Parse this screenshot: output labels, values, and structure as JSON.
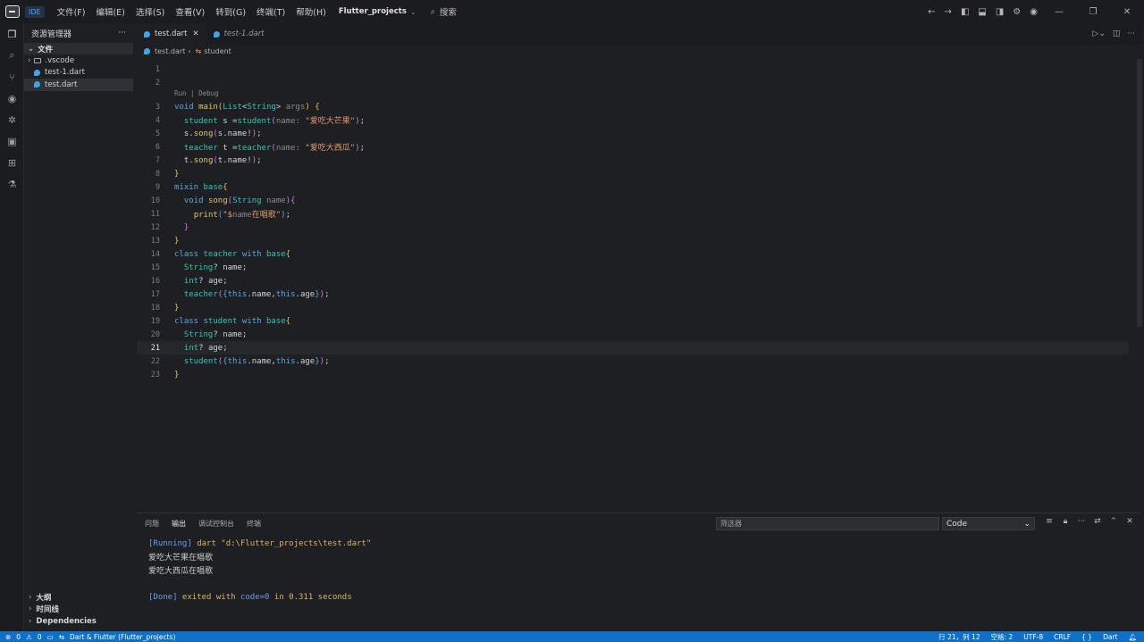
{
  "titlebar": {
    "ide_label": "IDE",
    "menus": [
      "文件(F)",
      "编辑(E)",
      "选择(S)",
      "查看(V)",
      "转到(G)",
      "终端(T)",
      "帮助(H)"
    ],
    "project": "Flutter_projects",
    "search": "搜索"
  },
  "sidebar": {
    "title": "资源管理器",
    "section": "文件",
    "items": [
      ".vscode",
      "test-1.dart",
      "test.dart"
    ],
    "bottom": [
      "大纲",
      "时间线",
      "Dependencies"
    ]
  },
  "editor": {
    "tabs": [
      "test.dart",
      "test-1.dart"
    ],
    "breadcrumb_file": "test.dart",
    "breadcrumb_symbol": "student",
    "codelens": "Run | Debug"
  },
  "code": [
    {
      "n": "1",
      "html": ""
    },
    {
      "n": "2",
      "html": ""
    },
    {
      "n": "3",
      "html": "<span class='k'>void</span> <span class='f'>main</span><span class='y'>(</span><span class='t'>List</span>&lt;<span class='t'>String</span>&gt; <span class='p'>args</span><span class='y'>)</span> <span class='y'>{</span>"
    },
    {
      "n": "4",
      "html": "  <span class='t'>student</span> <span class='v'>s</span> =<span class='t'>student</span><span class='m'>(</span><span class='p'>name:</span> <span class='s'>\"爱吃大芒果\"</span><span class='m'>)</span>;"
    },
    {
      "n": "5",
      "html": "  <span class='v'>s</span>.<span class='f'>song</span><span class='m'>(</span><span class='v'>s</span>.<span class='v'>name</span>!<span class='m'>)</span>;"
    },
    {
      "n": "6",
      "html": "  <span class='t'>teacher</span> <span class='v'>t</span> =<span class='t'>teacher</span><span class='m'>(</span><span class='p'>name:</span> <span class='s'>\"爱吃大西瓜\"</span><span class='m'>)</span>;"
    },
    {
      "n": "7",
      "html": "  <span class='v'>t</span>.<span class='f'>song</span><span class='m'>(</span><span class='v'>t</span>.<span class='v'>name</span>!<span class='m'>)</span>;"
    },
    {
      "n": "8",
      "html": "<span class='y'>}</span>"
    },
    {
      "n": "9",
      "html": "<span class='k'>mixin</span> <span class='t'>base</span><span class='y'>{</span>"
    },
    {
      "n": "10",
      "html": "  <span class='k'>void</span> <span class='f'>song</span><span class='m'>(</span><span class='t'>String</span> <span class='p'>name</span><span class='m'>){</span>"
    },
    {
      "n": "11",
      "html": "    <span class='f'>print</span><span class='k'>(</span><span class='s'>\"$</span><span class='p'>name</span><span class='s'>在唱歌\"</span><span class='k'>)</span>;"
    },
    {
      "n": "12",
      "html": "  <span class='m'>}</span>"
    },
    {
      "n": "13",
      "html": "<span class='y'>}</span>"
    },
    {
      "n": "14",
      "html": "<span class='k'>class</span> <span class='t'>teacher</span> <span class='k'>with</span> <span class='t'>base</span><span class='y'>{</span>"
    },
    {
      "n": "15",
      "html": "  <span class='t'>String</span>? <span class='v'>name</span>;"
    },
    {
      "n": "16",
      "html": "  <span class='t'>int</span>? <span class='v'>age</span>;"
    },
    {
      "n": "17",
      "html": "  <span class='t'>teacher</span><span class='m'>(</span><span class='k'>{</span><span class='k'>this</span>.<span class='v'>name</span>,<span class='k'>this</span>.<span class='v'>age</span><span class='k'>}</span><span class='m'>)</span>;"
    },
    {
      "n": "18",
      "html": "<span class='y'>}</span>"
    },
    {
      "n": "19",
      "html": "<span class='k'>class</span> <span class='t'>student</span> <span class='k'>with</span> <span class='t'>base</span><span class='y'>{</span>"
    },
    {
      "n": "20",
      "html": "  <span class='t'>String</span>? <span class='v'>name</span>;"
    },
    {
      "n": "21",
      "html": "  <span class='t'>int</span>? <span class='v'>age</span>;"
    },
    {
      "n": "22",
      "html": "  <span class='t'>student</span><span class='m'>(</span><span class='k'>{</span><span class='k'>this</span>.<span class='v'>name</span>,<span class='k'>this</span>.<span class='v'>age</span><span class='k'>}</span><span class='m'>)</span>;"
    },
    {
      "n": "23",
      "html": "<span class='y'>}</span>"
    }
  ],
  "panel": {
    "tabs": [
      "问题",
      "输出",
      "调试控制台",
      "终端"
    ],
    "filter_placeholder": "筛选器",
    "channel": "Code",
    "output_running_tag": "[Running]",
    "output_running_cmd": " dart \"d:\\Flutter_projects\\test.dart\"",
    "output_line1": "爱吃大芒果在唱歌",
    "output_line2": "爱吃大西瓜在唱歌",
    "output_done_tag": "[Done]",
    "output_done_a": " exited with ",
    "output_done_code": "code=0",
    "output_done_b": " in ",
    "output_done_time": "0.311",
    "output_done_c": " seconds"
  },
  "statusbar": {
    "errors": "0",
    "warnings": "0",
    "flutter": "Dart & Flutter (Flutter_projects)",
    "position": "行 21，列 12",
    "spaces": "空格: 2",
    "encoding": "UTF-8",
    "eol": "CRLF",
    "braces": "{ }",
    "language": "Dart"
  }
}
